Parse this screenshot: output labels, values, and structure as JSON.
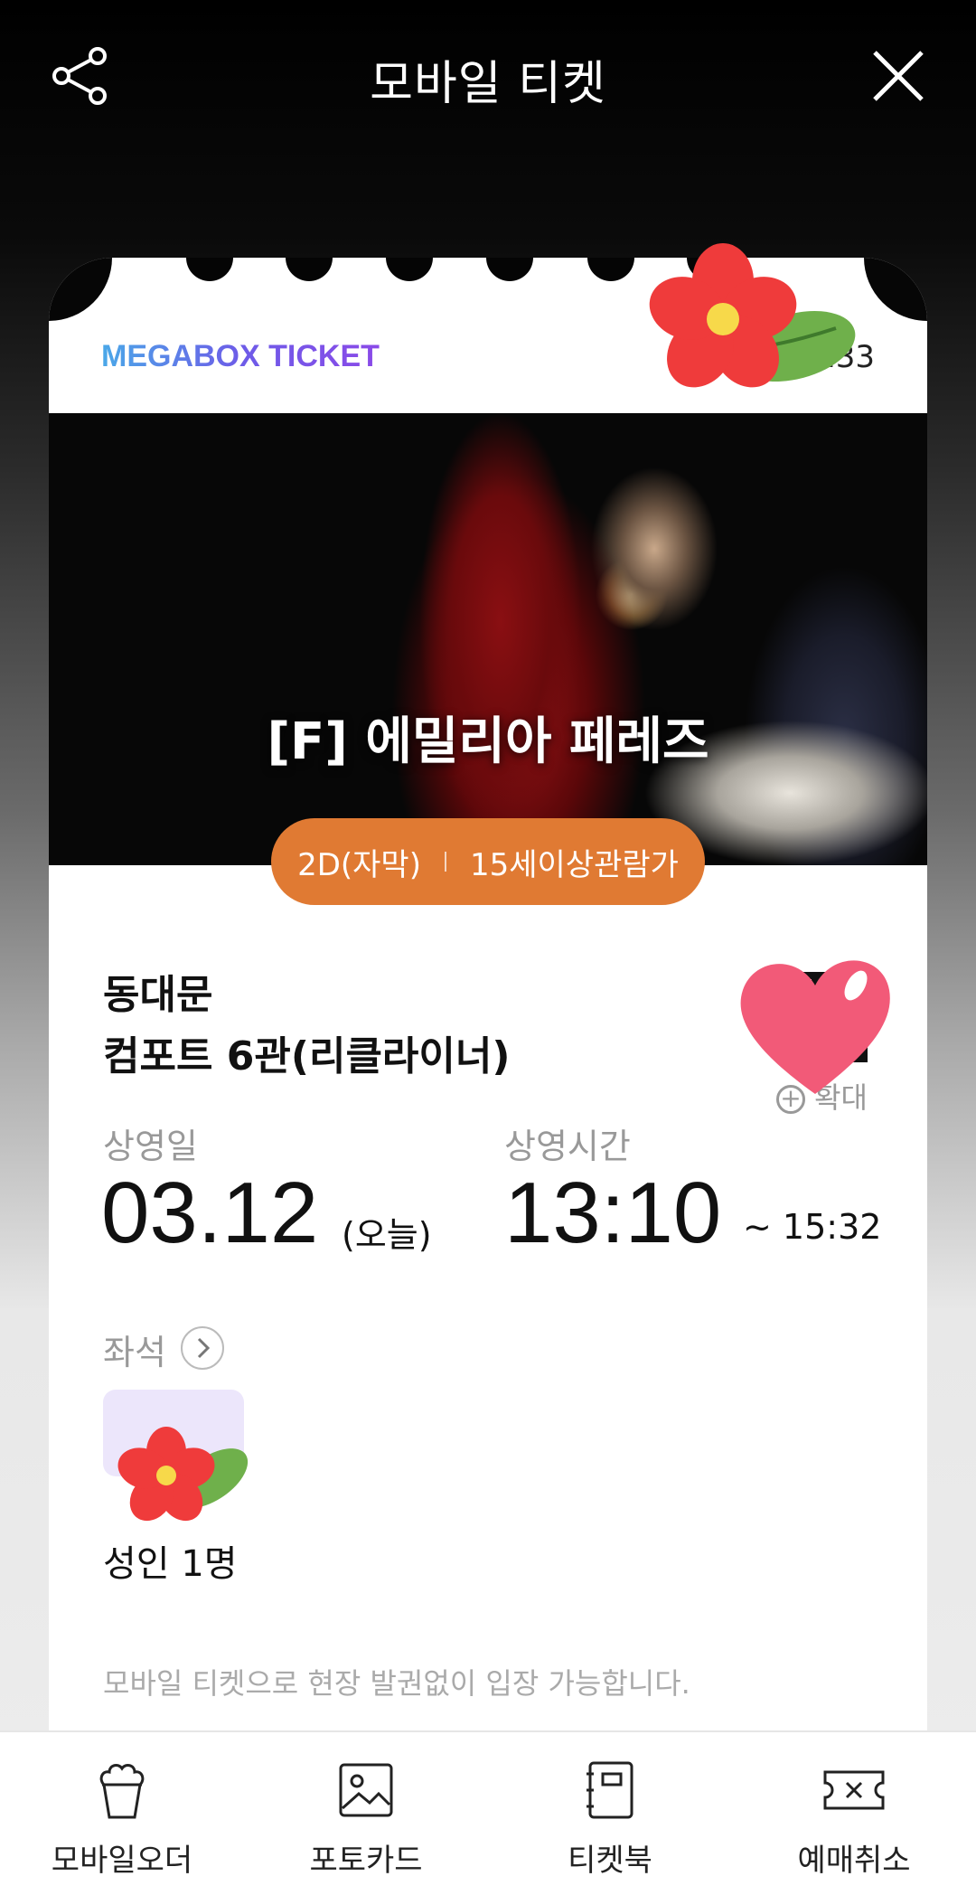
{
  "header": {
    "title": "모바일 티켓",
    "share_icon": "share-icon",
    "close_icon": "close-icon"
  },
  "ticket": {
    "brand": "MEGABOX TICKET",
    "booking_no": "905          233",
    "movie_title": "[F] 에밀리아 페레즈",
    "format": "2D(자막)",
    "rating": "15세이상관람가",
    "branch": "동대문",
    "screen": "컴포트 6관(리클라이너)",
    "zoom_label": "확대",
    "date_label": "상영일",
    "date_value": "03.12",
    "date_note": "(오늘)",
    "time_label": "상영시간",
    "time_start": "13:10",
    "time_end": "~ 15:32",
    "seat_label": "좌석",
    "audience": "성인 1명",
    "notice": "모바일 티켓으로 현장 발권없이 입장 가능합니다."
  },
  "bottom_nav": [
    {
      "label": "모바일오더",
      "icon": "popcorn-icon"
    },
    {
      "label": "포토카드",
      "icon": "photo-icon"
    },
    {
      "label": "티켓북",
      "icon": "ticket-book-icon"
    },
    {
      "label": "예매취소",
      "icon": "cancel-ticket-icon"
    }
  ],
  "colors": {
    "accent": "#e07a33",
    "brand_gradient_start": "#4aa8e8",
    "brand_gradient_end": "#8a4ae8"
  }
}
